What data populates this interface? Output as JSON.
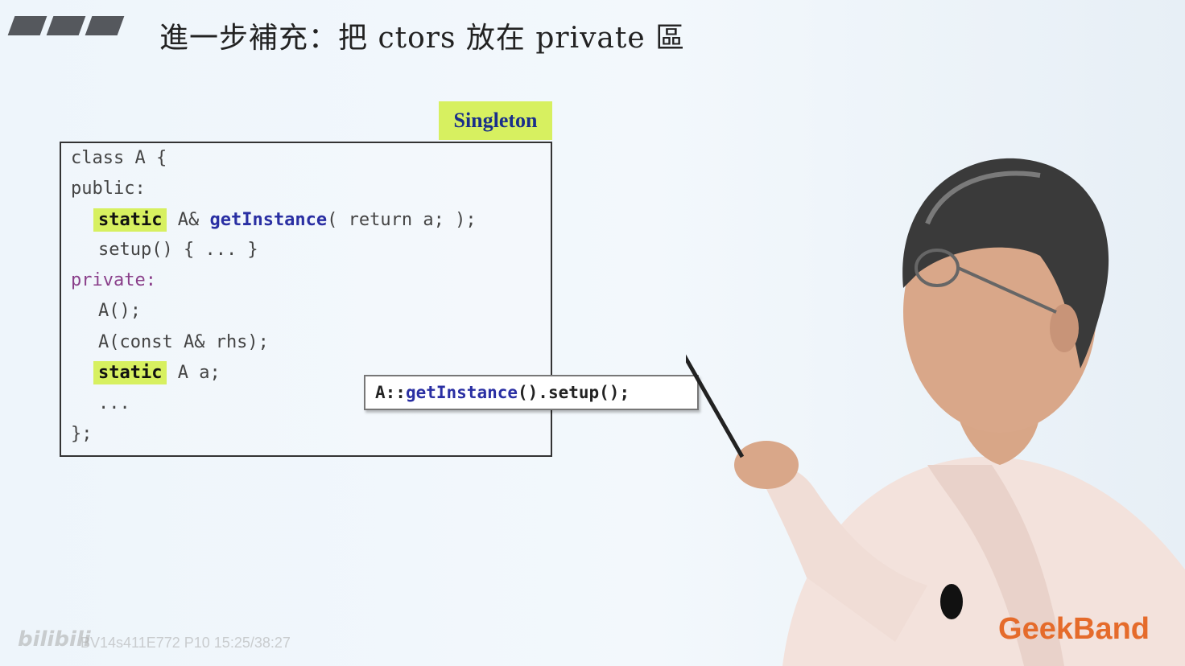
{
  "slide": {
    "title": "進一步補充：把 ctors 放在 private 區",
    "singleton_label": "Singleton"
  },
  "code": {
    "line1": "class A {",
    "line2": "public:",
    "line3_kw": "static",
    "line3_type": " A& ",
    "line3_fn": "getInstance",
    "line3_rest": "( return a; );",
    "line4": "setup() { ... }",
    "line5": "private:",
    "line6": "A();",
    "line7": "A(const A& rhs);",
    "line8_kw": "static",
    "line8_rest": " A a;",
    "line9": "...",
    "line10": "};"
  },
  "callout": {
    "prefix": "A::",
    "fn": "getInstance",
    "suffix": "().setup();"
  },
  "watermarks": {
    "bilibili": "bilibili",
    "video_id": "BV14s411E772 P10 15:25/38:27",
    "brand": "GeekBand"
  },
  "colors": {
    "highlight": "#d7f060",
    "function_blue": "#2a2fa3",
    "brand_orange": "#e56b2b"
  }
}
